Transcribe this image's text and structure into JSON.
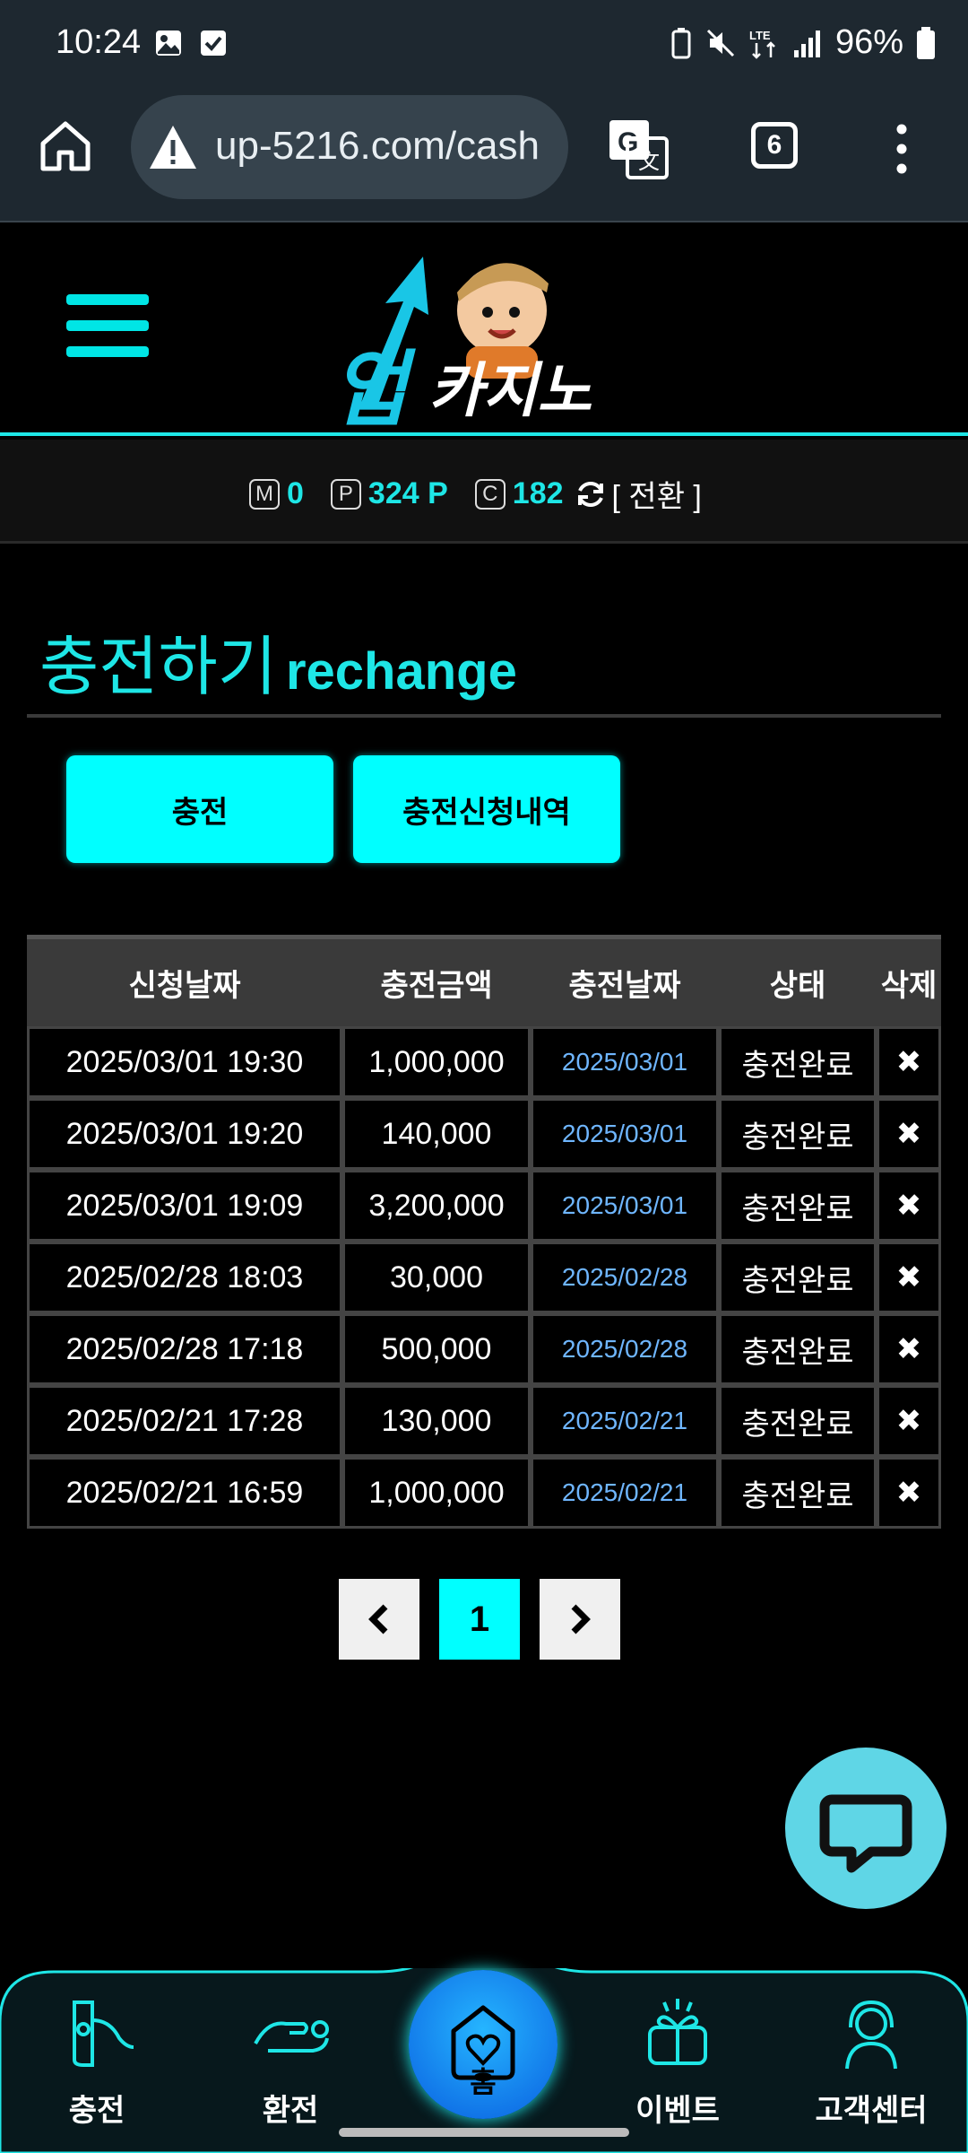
{
  "status_bar": {
    "time": "10:24",
    "battery": "96%"
  },
  "browser": {
    "url": "up-5216.com/cash",
    "tab_count": "6"
  },
  "balance": {
    "m_label": "M",
    "m_value": "0",
    "p_label": "P",
    "p_value": "324 P",
    "c_label": "C",
    "c_value": "182",
    "switch_label": "[ 전환 ]"
  },
  "page": {
    "title_ko": "충전하기",
    "title_en": "rechange",
    "btn_charge": "충전",
    "btn_history": "충전신청내역"
  },
  "table": {
    "headers": [
      "신청날짜",
      "충전금액",
      "충전날짜",
      "상태",
      "삭제"
    ],
    "rows": [
      {
        "requested": "2025/03/01 19:30",
        "amount": "1,000,000",
        "charged": "2025/03/01",
        "status": "충전완료",
        "delete": "✖"
      },
      {
        "requested": "2025/03/01 19:20",
        "amount": "140,000",
        "charged": "2025/03/01",
        "status": "충전완료",
        "delete": "✖"
      },
      {
        "requested": "2025/03/01 19:09",
        "amount": "3,200,000",
        "charged": "2025/03/01",
        "status": "충전완료",
        "delete": "✖"
      },
      {
        "requested": "2025/02/28 18:03",
        "amount": "30,000",
        "charged": "2025/02/28",
        "status": "충전완료",
        "delete": "✖"
      },
      {
        "requested": "2025/02/28 17:18",
        "amount": "500,000",
        "charged": "2025/02/28",
        "status": "충전완료",
        "delete": "✖"
      },
      {
        "requested": "2025/02/21 17:28",
        "amount": "130,000",
        "charged": "2025/02/21",
        "status": "충전완료",
        "delete": "✖"
      },
      {
        "requested": "2025/02/21 16:59",
        "amount": "1,000,000",
        "charged": "2025/02/21",
        "status": "충전완료",
        "delete": "✖"
      }
    ]
  },
  "pagination": {
    "prev": "‹",
    "current": "1",
    "next": "›"
  },
  "bottom_nav": {
    "charge": "충전",
    "exchange": "환전",
    "home": "홈",
    "event": "이벤트",
    "support": "고객센터"
  },
  "colors": {
    "accent": "#00ffff",
    "background": "#000000",
    "date_text": "#6fb6ff"
  }
}
